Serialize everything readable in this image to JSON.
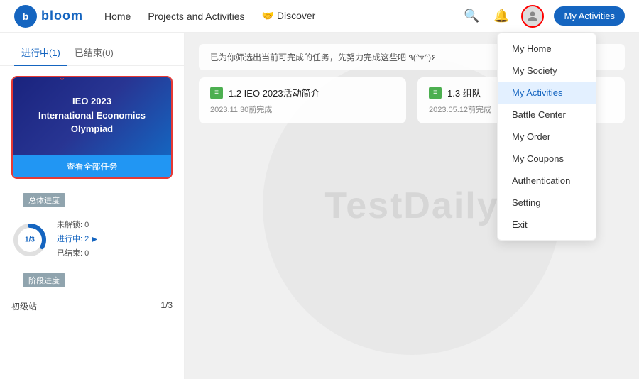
{
  "header": {
    "logo_text": "bloom",
    "logo_letter": "b",
    "nav": [
      {
        "label": "Home",
        "id": "home"
      },
      {
        "label": "Projects and Activities",
        "id": "projects"
      },
      {
        "label": "🤝 Discover",
        "id": "discover"
      }
    ],
    "my_activities_btn": "My Activities"
  },
  "dropdown": {
    "items": [
      {
        "label": "My Home",
        "id": "my-home",
        "active": false
      },
      {
        "label": "My Society",
        "id": "my-society",
        "active": false
      },
      {
        "label": "My Activities",
        "id": "my-activities",
        "active": true
      },
      {
        "label": "Battle Center",
        "id": "battle-center",
        "active": false
      },
      {
        "label": "My Order",
        "id": "my-order",
        "active": false
      },
      {
        "label": "My Coupons",
        "id": "my-coupons",
        "active": false
      },
      {
        "label": "Authentication",
        "id": "authentication",
        "active": false
      },
      {
        "label": "Setting",
        "id": "setting",
        "active": false
      },
      {
        "label": "Exit",
        "id": "exit",
        "active": false
      }
    ]
  },
  "sidebar": {
    "tabs": [
      {
        "label": "进行中(1)",
        "active": true
      },
      {
        "label": "已结束(0)",
        "active": false
      }
    ],
    "card": {
      "title": "IEO 2023",
      "subtitle": "International Economics\nOlympiad",
      "action": "查看全部任务"
    },
    "overall_label": "总体进度",
    "progress": {
      "fraction": "1/3",
      "stats": [
        {
          "label": "未解锁: 0"
        },
        {
          "label": "进行中: 2"
        },
        {
          "label": "已结束: 0"
        }
      ]
    },
    "phase_label": "阶段进度",
    "phases": [
      {
        "label": "初级站",
        "value": "1/3"
      }
    ]
  },
  "content": {
    "task_bar_text": "已为你筛选出当前可完成的任务，先努力完成这些吧 ٩(^▿^)۶",
    "watermark": "TestDaily",
    "tasks": [
      {
        "title": "1.2 IEO 2023活动简介",
        "date": "2023.11.30前完成",
        "icon": "≡"
      },
      {
        "title": "1.3 组队",
        "date": "2023.05.12前完成",
        "icon": "≡"
      }
    ]
  }
}
